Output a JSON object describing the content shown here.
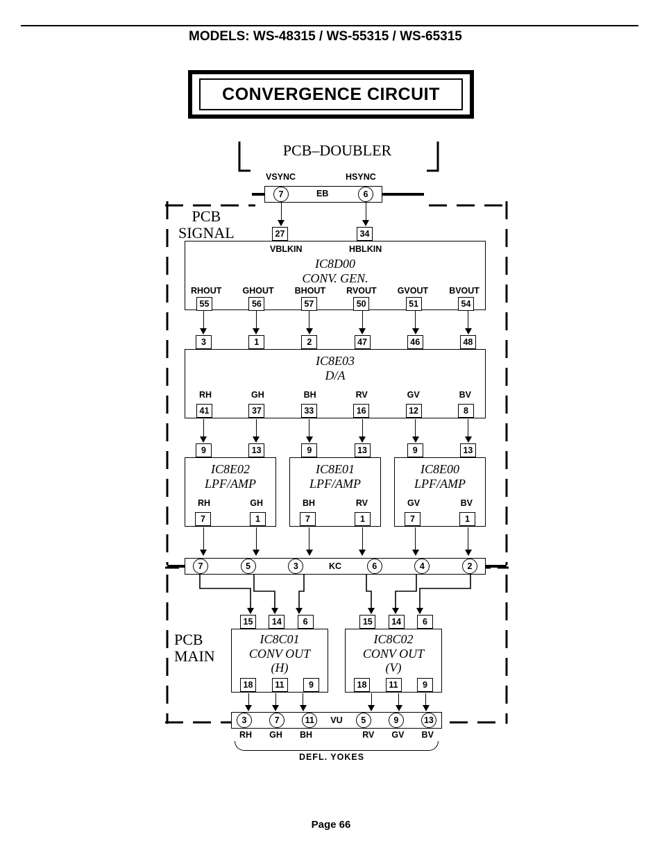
{
  "header": {
    "models": "MODELS: WS-48315 / WS-55315 / WS-65315"
  },
  "title": "CONVERGENCE CIRCUIT",
  "footer": "Page 66",
  "labels": {
    "pcb_doubler": "PCB–DOUBLER",
    "pcb_signal_l1": "PCB",
    "pcb_signal_l2": "SIGNAL",
    "pcb_main_l1": "PCB",
    "pcb_main_l2": "MAIN",
    "vsync": "VSYNC",
    "hsync": "HSYNC",
    "eb": "EB",
    "vblkin": "VBLKIN",
    "hblkin": "HBLKIN",
    "kc": "KC",
    "vu": "VU",
    "defl": "DEFL.  YOKES",
    "rh": "RH",
    "gh": "GH",
    "bh": "BH",
    "rv": "RV",
    "gv": "GV",
    "bv": "BV"
  },
  "doubler_pins": {
    "vsync": "7",
    "hsync": "6"
  },
  "signal_in_pins": {
    "v": "27",
    "h": "34"
  },
  "ic8d00": {
    "name": "IC8D00",
    "desc": "CONV.  GEN.",
    "out_labels": [
      "RHOUT",
      "GHOUT",
      "BHOUT",
      "RVOUT",
      "GVOUT",
      "BVOUT"
    ],
    "out_pins": [
      "55",
      "56",
      "57",
      "50",
      "51",
      "54"
    ]
  },
  "ic8e03": {
    "name": "IC8E03",
    "desc": "D/A",
    "in_pins": [
      "3",
      "1",
      "2",
      "47",
      "46",
      "48"
    ],
    "out_labels": [
      "RH",
      "GH",
      "BH",
      "RV",
      "GV",
      "BV"
    ],
    "out_pins": [
      "41",
      "37",
      "33",
      "16",
      "12",
      "8"
    ]
  },
  "lpf_in_pins": [
    [
      "9",
      "13"
    ],
    [
      "9",
      "13"
    ],
    [
      "9",
      "13"
    ]
  ],
  "lpf": [
    {
      "name": "IC8E02",
      "desc": "LPF/AMP",
      "cols": [
        "RH",
        "GH"
      ],
      "out": [
        "7",
        "1"
      ]
    },
    {
      "name": "IC8E01",
      "desc": "LPF/AMP",
      "cols": [
        "BH",
        "RV"
      ],
      "out": [
        "7",
        "1"
      ]
    },
    {
      "name": "IC8E00",
      "desc": "LPF/AMP",
      "cols": [
        "GV",
        "BV"
      ],
      "out": [
        "7",
        "1"
      ]
    }
  ],
  "kc_pins": [
    "7",
    "5",
    "3",
    "6",
    "4",
    "2"
  ],
  "convout_in_pins": [
    [
      "15",
      "14",
      "6"
    ],
    [
      "15",
      "14",
      "6"
    ]
  ],
  "convout": [
    {
      "name": "IC8C01",
      "desc1": "CONV  OUT",
      "desc2": "(H)",
      "out": [
        "18",
        "11",
        "9"
      ]
    },
    {
      "name": "IC8C02",
      "desc1": "CONV  OUT",
      "desc2": "(V)",
      "out": [
        "18",
        "11",
        "9"
      ]
    }
  ],
  "vu_pins": [
    "3",
    "7",
    "11",
    "5",
    "9",
    "13"
  ],
  "yoke_labels": [
    "RH",
    "GH",
    "BH",
    "RV",
    "GV",
    "BV"
  ]
}
